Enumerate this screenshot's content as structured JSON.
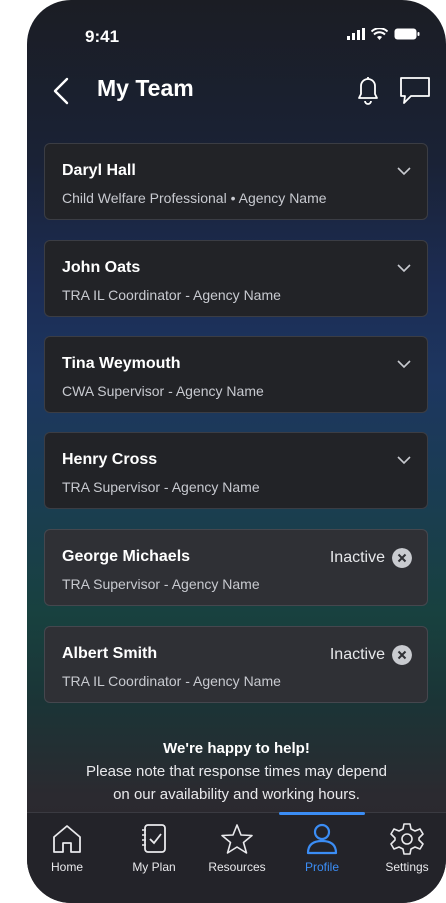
{
  "status_bar": {
    "time": "9:41"
  },
  "header": {
    "title": "My Team"
  },
  "team": [
    {
      "name": "Daryl Hall",
      "role": "Child Welfare Professional • Agency Name",
      "status": ""
    },
    {
      "name": "John Oats",
      "role": "TRA IL Coordinator - Agency Name",
      "status": ""
    },
    {
      "name": "Tina Weymouth",
      "role": "CWA Supervisor - Agency Name",
      "status": ""
    },
    {
      "name": "Henry Cross",
      "role": "TRA Supervisor - Agency Name",
      "status": ""
    },
    {
      "name": "George Michaels",
      "role": "TRA Supervisor - Agency Name",
      "status": "Inactive"
    },
    {
      "name": "Albert Smith",
      "role": "TRA IL Coordinator - Agency Name",
      "status": "Inactive"
    }
  ],
  "help": {
    "title": "We're happy to help!",
    "line1": "Please note that response times may depend",
    "line2": "on our availability and working hours."
  },
  "tabs": [
    {
      "label": "Home",
      "icon": "home-icon",
      "active": false
    },
    {
      "label": "My Plan",
      "icon": "plan-icon",
      "active": false
    },
    {
      "label": "Resources",
      "icon": "star-icon",
      "active": false
    },
    {
      "label": "Profile",
      "icon": "profile-icon",
      "active": true
    },
    {
      "label": "Settings",
      "icon": "gear-icon",
      "active": false
    }
  ],
  "colors": {
    "accent": "#3b8df5",
    "card": "#222327",
    "inactive_card": "#2f3035"
  }
}
